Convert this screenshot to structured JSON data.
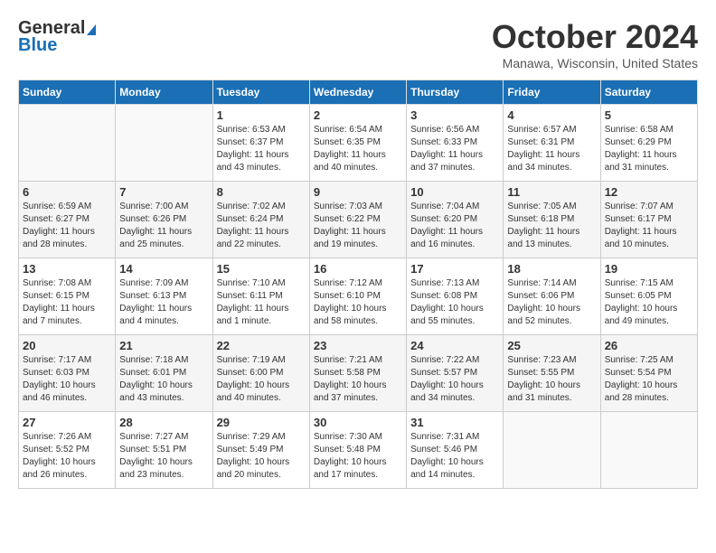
{
  "logo": {
    "general": "General",
    "blue": "Blue"
  },
  "title": "October 2024",
  "location": "Manawa, Wisconsin, United States",
  "weekdays": [
    "Sunday",
    "Monday",
    "Tuesday",
    "Wednesday",
    "Thursday",
    "Friday",
    "Saturday"
  ],
  "weeks": [
    [
      {
        "day": "",
        "info": ""
      },
      {
        "day": "",
        "info": ""
      },
      {
        "day": "1",
        "info": "Sunrise: 6:53 AM\nSunset: 6:37 PM\nDaylight: 11 hours and 43 minutes."
      },
      {
        "day": "2",
        "info": "Sunrise: 6:54 AM\nSunset: 6:35 PM\nDaylight: 11 hours and 40 minutes."
      },
      {
        "day": "3",
        "info": "Sunrise: 6:56 AM\nSunset: 6:33 PM\nDaylight: 11 hours and 37 minutes."
      },
      {
        "day": "4",
        "info": "Sunrise: 6:57 AM\nSunset: 6:31 PM\nDaylight: 11 hours and 34 minutes."
      },
      {
        "day": "5",
        "info": "Sunrise: 6:58 AM\nSunset: 6:29 PM\nDaylight: 11 hours and 31 minutes."
      }
    ],
    [
      {
        "day": "6",
        "info": "Sunrise: 6:59 AM\nSunset: 6:27 PM\nDaylight: 11 hours and 28 minutes."
      },
      {
        "day": "7",
        "info": "Sunrise: 7:00 AM\nSunset: 6:26 PM\nDaylight: 11 hours and 25 minutes."
      },
      {
        "day": "8",
        "info": "Sunrise: 7:02 AM\nSunset: 6:24 PM\nDaylight: 11 hours and 22 minutes."
      },
      {
        "day": "9",
        "info": "Sunrise: 7:03 AM\nSunset: 6:22 PM\nDaylight: 11 hours and 19 minutes."
      },
      {
        "day": "10",
        "info": "Sunrise: 7:04 AM\nSunset: 6:20 PM\nDaylight: 11 hours and 16 minutes."
      },
      {
        "day": "11",
        "info": "Sunrise: 7:05 AM\nSunset: 6:18 PM\nDaylight: 11 hours and 13 minutes."
      },
      {
        "day": "12",
        "info": "Sunrise: 7:07 AM\nSunset: 6:17 PM\nDaylight: 11 hours and 10 minutes."
      }
    ],
    [
      {
        "day": "13",
        "info": "Sunrise: 7:08 AM\nSunset: 6:15 PM\nDaylight: 11 hours and 7 minutes."
      },
      {
        "day": "14",
        "info": "Sunrise: 7:09 AM\nSunset: 6:13 PM\nDaylight: 11 hours and 4 minutes."
      },
      {
        "day": "15",
        "info": "Sunrise: 7:10 AM\nSunset: 6:11 PM\nDaylight: 11 hours and 1 minute."
      },
      {
        "day": "16",
        "info": "Sunrise: 7:12 AM\nSunset: 6:10 PM\nDaylight: 10 hours and 58 minutes."
      },
      {
        "day": "17",
        "info": "Sunrise: 7:13 AM\nSunset: 6:08 PM\nDaylight: 10 hours and 55 minutes."
      },
      {
        "day": "18",
        "info": "Sunrise: 7:14 AM\nSunset: 6:06 PM\nDaylight: 10 hours and 52 minutes."
      },
      {
        "day": "19",
        "info": "Sunrise: 7:15 AM\nSunset: 6:05 PM\nDaylight: 10 hours and 49 minutes."
      }
    ],
    [
      {
        "day": "20",
        "info": "Sunrise: 7:17 AM\nSunset: 6:03 PM\nDaylight: 10 hours and 46 minutes."
      },
      {
        "day": "21",
        "info": "Sunrise: 7:18 AM\nSunset: 6:01 PM\nDaylight: 10 hours and 43 minutes."
      },
      {
        "day": "22",
        "info": "Sunrise: 7:19 AM\nSunset: 6:00 PM\nDaylight: 10 hours and 40 minutes."
      },
      {
        "day": "23",
        "info": "Sunrise: 7:21 AM\nSunset: 5:58 PM\nDaylight: 10 hours and 37 minutes."
      },
      {
        "day": "24",
        "info": "Sunrise: 7:22 AM\nSunset: 5:57 PM\nDaylight: 10 hours and 34 minutes."
      },
      {
        "day": "25",
        "info": "Sunrise: 7:23 AM\nSunset: 5:55 PM\nDaylight: 10 hours and 31 minutes."
      },
      {
        "day": "26",
        "info": "Sunrise: 7:25 AM\nSunset: 5:54 PM\nDaylight: 10 hours and 28 minutes."
      }
    ],
    [
      {
        "day": "27",
        "info": "Sunrise: 7:26 AM\nSunset: 5:52 PM\nDaylight: 10 hours and 26 minutes."
      },
      {
        "day": "28",
        "info": "Sunrise: 7:27 AM\nSunset: 5:51 PM\nDaylight: 10 hours and 23 minutes."
      },
      {
        "day": "29",
        "info": "Sunrise: 7:29 AM\nSunset: 5:49 PM\nDaylight: 10 hours and 20 minutes."
      },
      {
        "day": "30",
        "info": "Sunrise: 7:30 AM\nSunset: 5:48 PM\nDaylight: 10 hours and 17 minutes."
      },
      {
        "day": "31",
        "info": "Sunrise: 7:31 AM\nSunset: 5:46 PM\nDaylight: 10 hours and 14 minutes."
      },
      {
        "day": "",
        "info": ""
      },
      {
        "day": "",
        "info": ""
      }
    ]
  ]
}
